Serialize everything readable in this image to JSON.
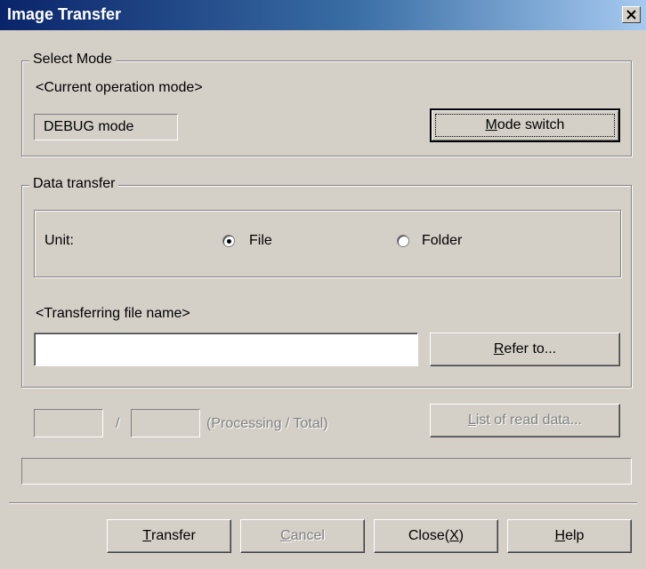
{
  "window": {
    "title": "Image Transfer",
    "close_symbol": "×"
  },
  "select_mode": {
    "legend": "Select Mode",
    "current_label": "<Current operation mode>",
    "current_mode": "DEBUG mode",
    "switch_button": {
      "mnemonic": "M",
      "rest": "ode switch"
    }
  },
  "data_transfer": {
    "legend": "Data transfer",
    "unit_label": "Unit:",
    "options": [
      {
        "label": "File",
        "selected": true
      },
      {
        "label": "Folder",
        "selected": false
      }
    ],
    "file_name_label": "<Transferring file name>",
    "file_name_value": "",
    "refer_button": {
      "mnemonic": "R",
      "rest": "efer to..."
    }
  },
  "progress": {
    "processing": "",
    "separator": "/",
    "total": "",
    "caption": "(Processing / Total)",
    "list_button": {
      "mnemonic": "L",
      "rest": "ist of read data..."
    },
    "fraction": 0
  },
  "footer": {
    "transfer": {
      "mnemonic": "T",
      "rest": "ransfer"
    },
    "cancel": {
      "mnemonic": "C",
      "rest": "ancel"
    },
    "close": {
      "before": "Close(",
      "mnemonic": "X",
      "after": ")"
    },
    "help": {
      "mnemonic": "H",
      "rest": "elp"
    }
  },
  "colors": {
    "face": "#d4d0c8",
    "title_start": "#0a246a",
    "title_end": "#a6caf0",
    "disabled": "#808080"
  }
}
